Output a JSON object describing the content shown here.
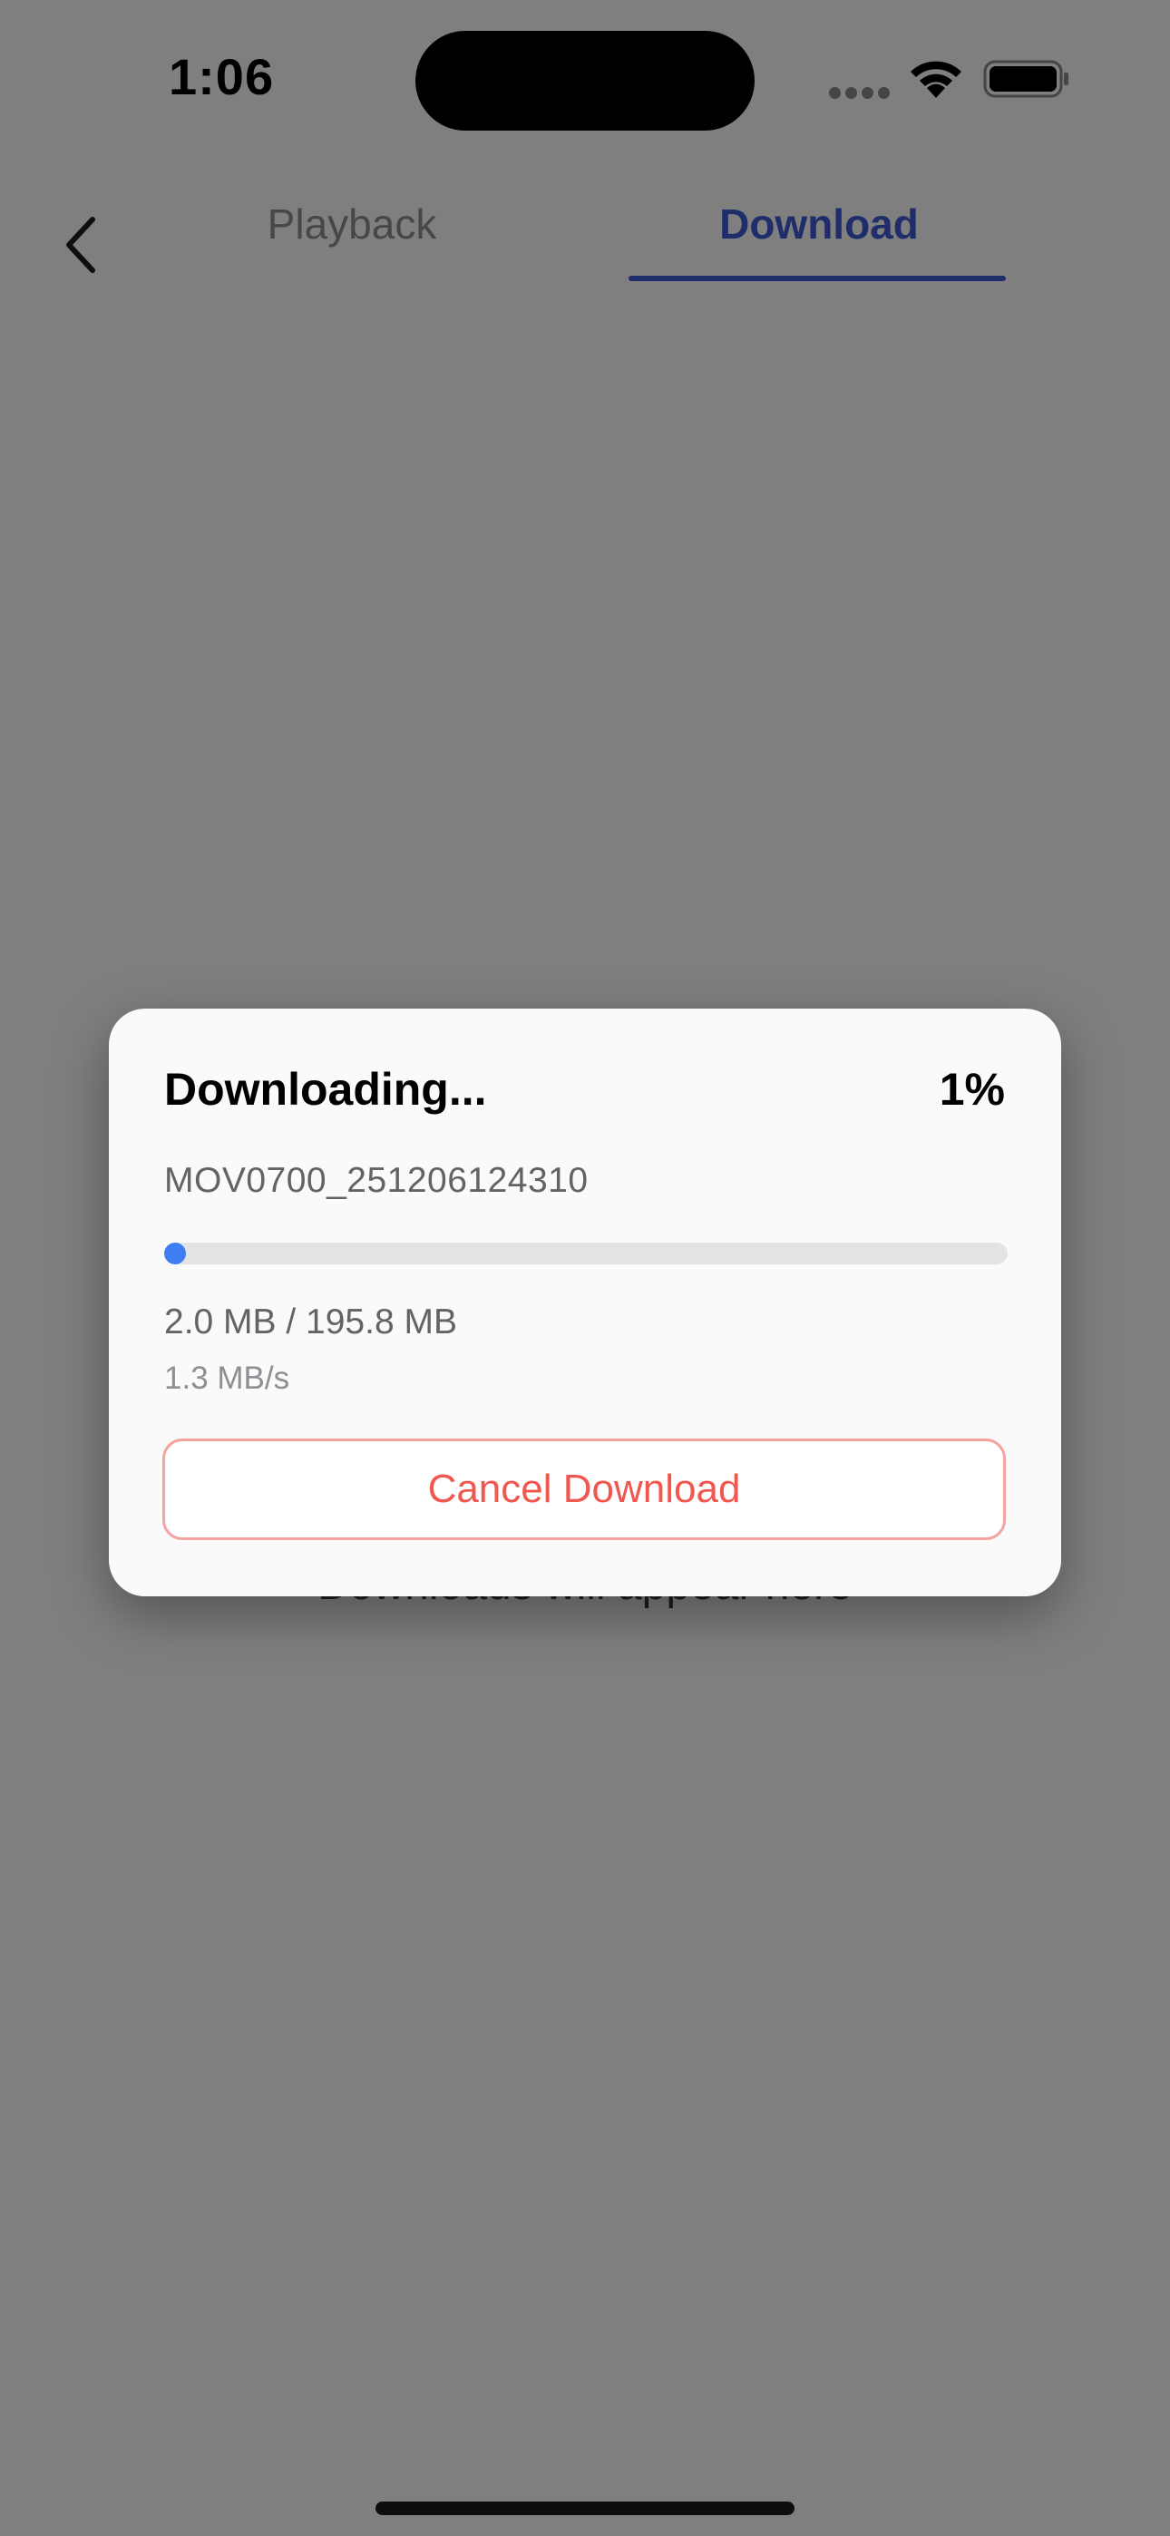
{
  "status_bar": {
    "time": "1:06",
    "signal_icon": "cellular-signal-icon",
    "wifi_icon": "wifi-icon",
    "battery_icon": "battery-icon"
  },
  "nav": {
    "back_icon": "chevron-left-icon",
    "tabs": [
      {
        "label": "Playback",
        "active": false
      },
      {
        "label": "Download",
        "active": true
      }
    ]
  },
  "content": {
    "empty_message": "Downloads will appear here"
  },
  "dialog": {
    "title": "Downloading...",
    "percent_label": "1%",
    "progress_fraction": 0.01,
    "filename": "MOV0700_251206124310",
    "size_text": "2.0 MB / 195.8 MB",
    "speed_text": "1.3 MB/s",
    "cancel_label": "Cancel Download"
  },
  "colors": {
    "accent": "#3e5bd6",
    "progress": "#3f7df2",
    "danger": "#f0584f",
    "danger_border": "#f4a3a0",
    "overlay": "rgba(0,0,0,0.5)"
  }
}
